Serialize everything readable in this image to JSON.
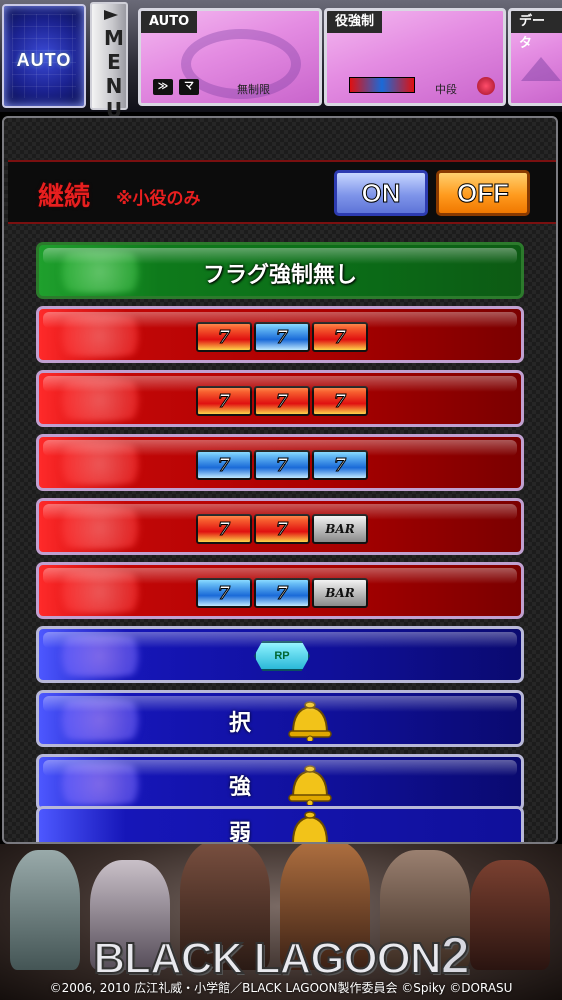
{
  "topbar": {
    "auto_label": "AUTO",
    "menu_label": "MENU",
    "panels": [
      {
        "title": "AUTO",
        "sub": "無制限",
        "chips": [
          "≫",
          "マ"
        ]
      },
      {
        "title": "役強制",
        "sub": "中段"
      },
      {
        "title": "データ"
      }
    ]
  },
  "continue_bar": {
    "label": "継続",
    "note": "※小役のみ",
    "on_label": "ON",
    "off_label": "OFF",
    "selected": "OFF"
  },
  "flags": [
    {
      "type": "text",
      "color": "green",
      "label": "フラグ強制無し"
    },
    {
      "type": "symbols",
      "color": "red",
      "symbols": [
        "seven-red",
        "seven-blue",
        "seven-red"
      ]
    },
    {
      "type": "symbols",
      "color": "red",
      "symbols": [
        "seven-red",
        "seven-red",
        "seven-red"
      ]
    },
    {
      "type": "symbols",
      "color": "red",
      "symbols": [
        "seven-blue",
        "seven-blue",
        "seven-blue"
      ]
    },
    {
      "type": "symbols",
      "color": "red",
      "symbols": [
        "seven-red",
        "seven-red",
        "bar"
      ]
    },
    {
      "type": "symbols",
      "color": "red",
      "symbols": [
        "seven-blue",
        "seven-blue",
        "bar"
      ]
    },
    {
      "type": "badge",
      "color": "blue",
      "label": "RP"
    },
    {
      "type": "bell",
      "color": "blue",
      "label": "択"
    },
    {
      "type": "bell",
      "color": "blue",
      "label": "強"
    },
    {
      "type": "bell",
      "color": "blue",
      "label": "弱"
    }
  ],
  "symbol_text": {
    "seven-red": "7",
    "seven-blue": "7",
    "bar": "BAR"
  },
  "banner": {
    "logo": "BLACK LAGOON",
    "logo_number": "2",
    "copyright": "©2006, 2010 広江礼威・小学館／BLACK LAGOON製作委員会 ©Spiky ©DORASU"
  },
  "colors": {
    "continue_text": "#e81f1f",
    "on_button": "#7f95ea",
    "off_button": "#ff9b1e"
  }
}
